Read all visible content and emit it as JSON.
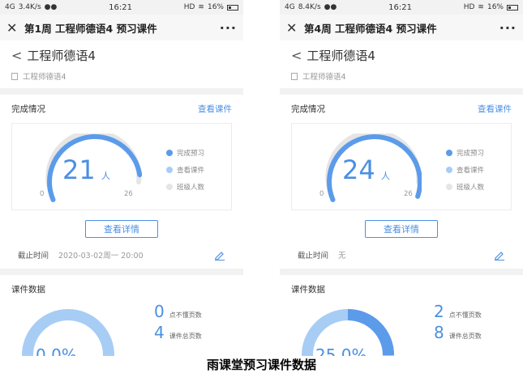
{
  "screens": [
    {
      "status": {
        "signal": "4G",
        "speed": "3.4K/s",
        "time": "16:21",
        "hd": "HD",
        "battery": "16%"
      },
      "window_title": "第1周 工程师德语4 预习课件",
      "course_title": "工程师德语4",
      "course_subtitle": "工程师德语4",
      "completion": {
        "title": "完成情况",
        "link": "查看课件",
        "count": "21",
        "unit": "人",
        "min": "0",
        "max": "26",
        "legend": [
          "完成预习",
          "查看课件",
          "班级人数"
        ],
        "progress": 0.8077,
        "colors": {
          "done": "#5b9bea",
          "viewed": "#a7cdf5",
          "total": "#e5e5e5"
        },
        "button": "查看详情"
      },
      "deadline": {
        "label": "截止时间",
        "value": "2020-03-02周一 20:00"
      },
      "data": {
        "title": "课件数据",
        "percent": "0.0%",
        "ratio": 0.0,
        "stat1_num": "0",
        "stat1_label": "点不懂页数",
        "stat2_num": "4",
        "stat2_label": "课件总页数"
      }
    },
    {
      "status": {
        "signal": "4G",
        "speed": "8.4K/s",
        "time": "16:21",
        "hd": "HD",
        "battery": "16%"
      },
      "window_title": "第4周 工程师德语4 预习课件",
      "course_title": "工程师德语4",
      "course_subtitle": "工程师德语4",
      "completion": {
        "title": "完成情况",
        "link": "查看课件",
        "count": "24",
        "unit": "人",
        "min": "0",
        "max": "26",
        "legend": [
          "完成预习",
          "查看课件",
          "班级人数"
        ],
        "progress": 0.9231,
        "colors": {
          "done": "#5b9bea",
          "viewed": "#a7cdf5",
          "total": "#e5e5e5"
        },
        "button": "查看详情"
      },
      "deadline": {
        "label": "截止时间",
        "value": "无"
      },
      "data": {
        "title": "课件数据",
        "percent": "25.0%",
        "ratio": 0.25,
        "stat1_num": "2",
        "stat1_label": "点不懂页数",
        "stat2_num": "8",
        "stat2_label": "课件总页数"
      }
    }
  ],
  "caption": "雨课堂预习课件数据"
}
